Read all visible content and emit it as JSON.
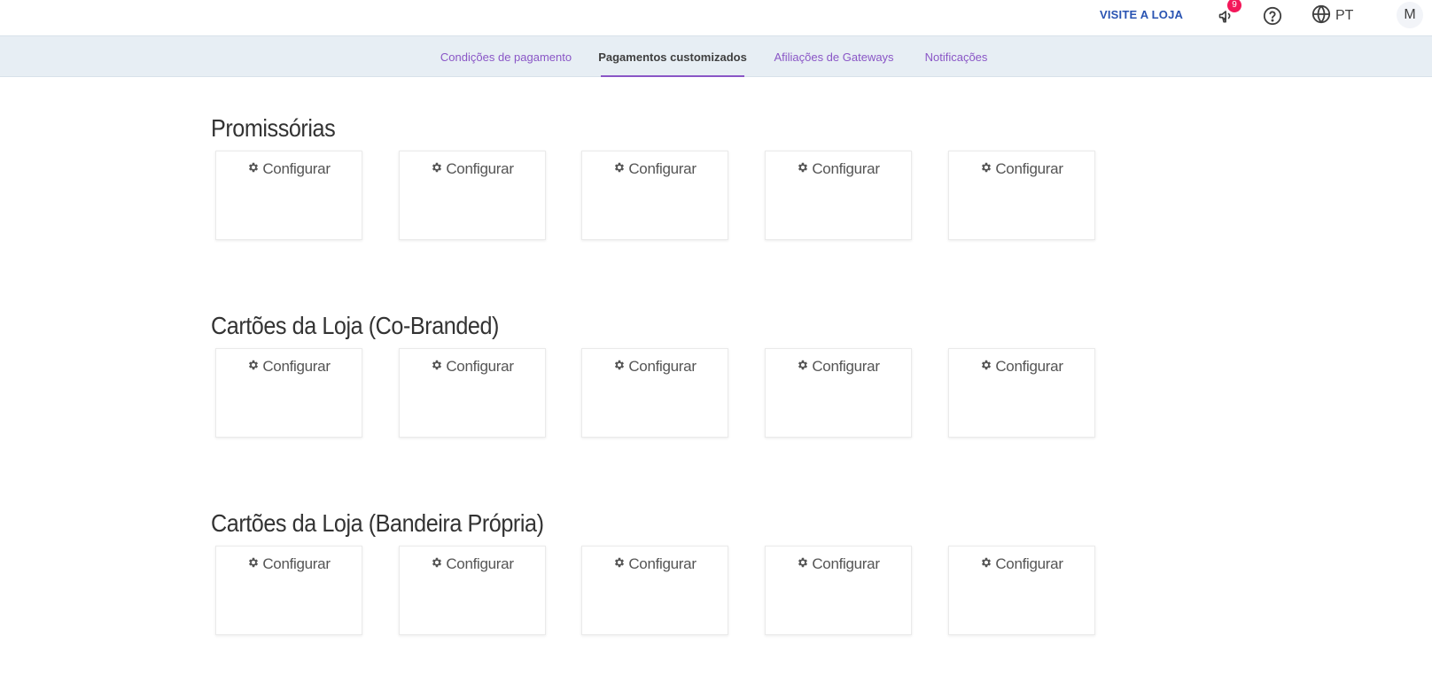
{
  "header": {
    "visit_store_label": "VISITE A LOJA",
    "notifications_count": "9",
    "language": "PT",
    "avatar_initial": "M",
    "badge_color": "#f3185a",
    "link_color": "#2953b2"
  },
  "tabs": [
    {
      "label": "Condições de pagamento",
      "active": false
    },
    {
      "label": "Pagamentos customizados",
      "active": true
    },
    {
      "label": "Afiliações de Gateways",
      "active": false
    },
    {
      "label": "Notificações",
      "active": false
    }
  ],
  "accent_color": "#8a56c6",
  "sections": [
    {
      "title": "Promissórias",
      "cards": [
        {
          "action_label": "Configurar",
          "icon": "gear-icon"
        },
        {
          "action_label": "Configurar",
          "icon": "gear-icon"
        },
        {
          "action_label": "Configurar",
          "icon": "gear-icon"
        },
        {
          "action_label": "Configurar",
          "icon": "gear-icon"
        },
        {
          "action_label": "Configurar",
          "icon": "gear-icon"
        }
      ]
    },
    {
      "title": "Cartões da Loja (Co-Branded)",
      "cards": [
        {
          "action_label": "Configurar",
          "icon": "gear-icon"
        },
        {
          "action_label": "Configurar",
          "icon": "gear-icon"
        },
        {
          "action_label": "Configurar",
          "icon": "gear-icon"
        },
        {
          "action_label": "Configurar",
          "icon": "gear-icon"
        },
        {
          "action_label": "Configurar",
          "icon": "gear-icon"
        }
      ]
    },
    {
      "title": "Cartões da Loja (Bandeira Própria)",
      "cards": [
        {
          "action_label": "Configurar",
          "icon": "gear-icon"
        },
        {
          "action_label": "Configurar",
          "icon": "gear-icon"
        },
        {
          "action_label": "Configurar",
          "icon": "gear-icon"
        },
        {
          "action_label": "Configurar",
          "icon": "gear-icon"
        },
        {
          "action_label": "Configurar",
          "icon": "gear-icon"
        }
      ]
    }
  ]
}
